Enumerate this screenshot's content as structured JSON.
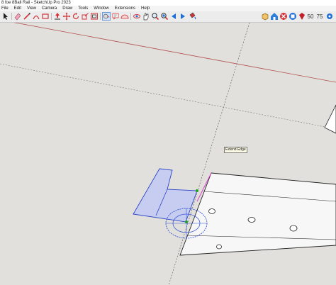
{
  "window": {
    "title": "8 foe 8Ball Rail - SketchUp Pro 2023"
  },
  "menu": {
    "items": [
      "File",
      "Edit",
      "View",
      "Camera",
      "Draw",
      "Tools",
      "Window",
      "Extensions",
      "Help"
    ]
  },
  "toolbar": {
    "left_icons": [
      "select-icon",
      "eraser-icon",
      "pencil-line-icon",
      "arc-icon",
      "rectangle-icon",
      "push-pull-icon",
      "move-icon",
      "rotate-icon",
      "scale-icon",
      "offset-icon",
      "tape-measure-icon",
      "text-icon",
      "protractor-icon",
      "orbit-icon",
      "pan-icon",
      "zoom-icon",
      "zoom-extents-icon",
      "previous-view-icon",
      "next-view-icon",
      "paint-bucket-icon"
    ],
    "right_icons": [
      "components-icon",
      "3d-warehouse-icon",
      "extension-warehouse-icon",
      "layout-icon",
      "ruby-console-icon"
    ],
    "accent_red": "#d13438",
    "accent_blue": "#1e6fd9"
  },
  "viewport": {
    "tooltip": "Extend Edge",
    "colors": {
      "background": "#e2e0dc",
      "red_axis": "#b05050",
      "green_axis": "#555555",
      "selection_fill": "#c7cdf0",
      "selection_edge": "#2b45c8",
      "magenta_edge": "#e040d0",
      "protractor": "#3555d8",
      "endpoint": "#22a022"
    }
  }
}
